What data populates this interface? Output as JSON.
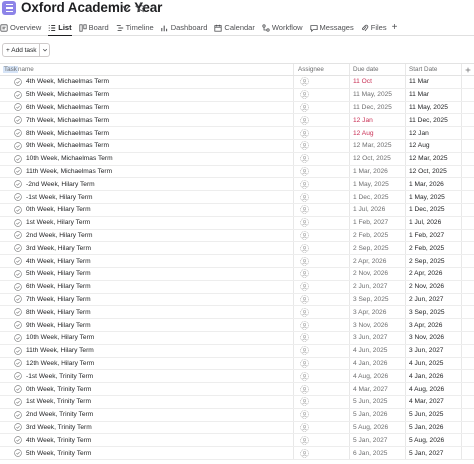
{
  "project": {
    "title": "Oxford Academic Year"
  },
  "tabs": [
    {
      "label": "Overview"
    },
    {
      "label": "List"
    },
    {
      "label": "Board"
    },
    {
      "label": "Timeline"
    },
    {
      "label": "Dashboard"
    },
    {
      "label": "Calendar"
    },
    {
      "label": "Workflow"
    },
    {
      "label": "Messages"
    },
    {
      "label": "Files"
    }
  ],
  "toolbar": {
    "add_task_label": "+ Add task"
  },
  "columns": {
    "task_name": "Task name",
    "task_name_highlight": "Task",
    "task_name_rest": " name",
    "assignee": "Assignee",
    "due_date": "Due date",
    "start_date": "Start Date"
  },
  "colors": {
    "accent": "#8d84e8",
    "overdue": "#c92f54"
  },
  "rows": [
    {
      "name": "4th Week, Michaelmas Term",
      "due": "11 Oct",
      "start": "11 Mar",
      "overdue": true
    },
    {
      "name": "5th Week, Michaelmas Term",
      "due": "11 May, 2025",
      "start": "11 Mar",
      "overdue": false
    },
    {
      "name": "6th Week, Michaelmas Term",
      "due": "11 Dec, 2025",
      "start": "11 May, 2025",
      "overdue": false
    },
    {
      "name": "7th Week, Michaelmas Term",
      "due": "12 Jan",
      "start": "11 Dec, 2025",
      "overdue": true
    },
    {
      "name": "8th Week, Michaelmas Term",
      "due": "12 Aug",
      "start": "12 Jan",
      "overdue": true
    },
    {
      "name": "9th Week, Michaelmas Term",
      "due": "12 Mar, 2025",
      "start": "12 Aug",
      "overdue": false
    },
    {
      "name": "10th Week, Michaelmas Term",
      "due": "12 Oct, 2025",
      "start": "12 Mar, 2025",
      "overdue": false
    },
    {
      "name": "11th Week, Michaelmas Term",
      "due": "1 Mar, 2026",
      "start": "12 Oct, 2025",
      "overdue": false
    },
    {
      "name": "-2nd Week, Hilary Term",
      "due": "1 May, 2025",
      "start": "1 Mar, 2026",
      "overdue": false
    },
    {
      "name": "-1st Week, Hilary Term",
      "due": "1 Dec, 2025",
      "start": "1 May, 2025",
      "overdue": false
    },
    {
      "name": "0th Week, Hilary Term",
      "due": "1 Jul, 2026",
      "start": "1 Dec, 2025",
      "overdue": false
    },
    {
      "name": "1st Week, Hilary Term",
      "due": "1 Feb, 2027",
      "start": "1 Jul, 2026",
      "overdue": false
    },
    {
      "name": "2nd Week, Hilary Term",
      "due": "2 Feb, 2025",
      "start": "1 Feb, 2027",
      "overdue": false
    },
    {
      "name": "3rd Week, Hilary Term",
      "due": "2 Sep, 2025",
      "start": "2 Feb, 2025",
      "overdue": false
    },
    {
      "name": "4th Week, Hilary Term",
      "due": "2 Apr, 2026",
      "start": "2 Sep, 2025",
      "overdue": false
    },
    {
      "name": "5th Week, Hilary Term",
      "due": "2 Nov, 2026",
      "start": "2 Apr, 2026",
      "overdue": false
    },
    {
      "name": "6th Week, Hilary Term",
      "due": "2 Jun, 2027",
      "start": "2 Nov, 2026",
      "overdue": false
    },
    {
      "name": "7th Week, Hilary Term",
      "due": "3 Sep, 2025",
      "start": "2 Jun, 2027",
      "overdue": false
    },
    {
      "name": "8th Week, Hilary Term",
      "due": "3 Apr, 2026",
      "start": "3 Sep, 2025",
      "overdue": false
    },
    {
      "name": "9th Week, Hilary Term",
      "due": "3 Nov, 2026",
      "start": "3 Apr, 2026",
      "overdue": false
    },
    {
      "name": "10th Week, Hilary Term",
      "due": "3 Jun, 2027",
      "start": "3 Nov, 2026",
      "overdue": false
    },
    {
      "name": "11th Week, Hilary Term",
      "due": "4 Jun, 2025",
      "start": "3 Jun, 2027",
      "overdue": false
    },
    {
      "name": "12th Week, Hilary Term",
      "due": "4 Jan, 2026",
      "start": "4 Jun, 2025",
      "overdue": false
    },
    {
      "name": "-1st Week, Trinity Term",
      "due": "4 Aug, 2026",
      "start": "4 Jan, 2026",
      "overdue": false
    },
    {
      "name": "0th Week, Trinity Term",
      "due": "4 Mar, 2027",
      "start": "4 Aug, 2026",
      "overdue": false
    },
    {
      "name": "1st Week, Trinity Term",
      "due": "5 Jun, 2025",
      "start": "4 Mar, 2027",
      "overdue": false
    },
    {
      "name": "2nd Week, Trinity Term",
      "due": "5 Jan, 2026",
      "start": "5 Jun, 2025",
      "overdue": false
    },
    {
      "name": "3rd Week, Trinity Term",
      "due": "5 Aug, 2026",
      "start": "5 Jan, 2026",
      "overdue": false
    },
    {
      "name": "4th Week, Trinity Term",
      "due": "5 Jan, 2027",
      "start": "5 Aug, 2026",
      "overdue": false
    },
    {
      "name": "5th Week, Trinity Term",
      "due": "6 Jan, 2025",
      "start": "5 Jan, 2027",
      "overdue": false
    }
  ]
}
